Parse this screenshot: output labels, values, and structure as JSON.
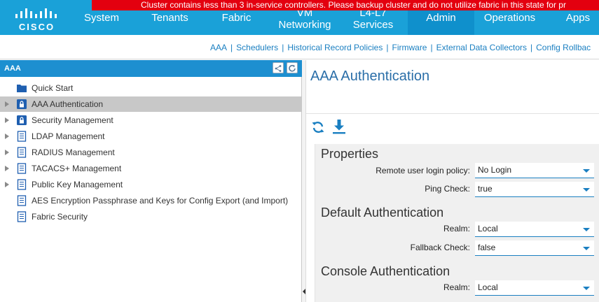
{
  "alert": {
    "text": "Cluster contains less than 3 in-service controllers. Please backup cluster and do not utilize fabric in this state for pr"
  },
  "logo": {
    "text": "CISCO"
  },
  "nav": {
    "system": "System",
    "tenants": "Tenants",
    "fabric": "Fabric",
    "vm_networking_1": "VM",
    "vm_networking_2": "Networking",
    "l4l7_1": "L4-L7",
    "l4l7_2": "Services",
    "admin": "Admin",
    "operations": "Operations",
    "apps": "Apps"
  },
  "subnav": {
    "items": [
      "AAA",
      "Schedulers",
      "Historical Record Policies",
      "Firmware",
      "External Data Collectors",
      "Config Rollbac"
    ],
    "separator": "|"
  },
  "left_panel": {
    "header": "AAA",
    "items": [
      {
        "label": "Quick Start"
      },
      {
        "label": "AAA Authentication"
      },
      {
        "label": "Security Management"
      },
      {
        "label": "LDAP Management"
      },
      {
        "label": "RADIUS Management"
      },
      {
        "label": "TACACS+ Management"
      },
      {
        "label": "Public Key Management"
      },
      {
        "label": "AES Encryption Passphrase and Keys for Config Export (and Import)"
      },
      {
        "label": "Fabric Security"
      }
    ]
  },
  "content": {
    "title": "AAA Authentication",
    "properties": {
      "title": "Properties",
      "remote_login_label": "Remote user login policy:",
      "remote_login_value": "No Login",
      "ping_check_label": "Ping Check:",
      "ping_check_value": "true"
    },
    "default_auth": {
      "title": "Default Authentication",
      "realm_label": "Realm:",
      "realm_value": "Local",
      "fallback_label": "Fallback Check:",
      "fallback_value": "false"
    },
    "console_auth": {
      "title": "Console Authentication",
      "realm_label": "Realm:",
      "realm_value": "Local"
    }
  },
  "colors": {
    "brand_blue": "#1aa1d8",
    "active_tab": "#0f90cc",
    "alert_red": "#e3000f",
    "link_blue": "#1a7fc1"
  }
}
